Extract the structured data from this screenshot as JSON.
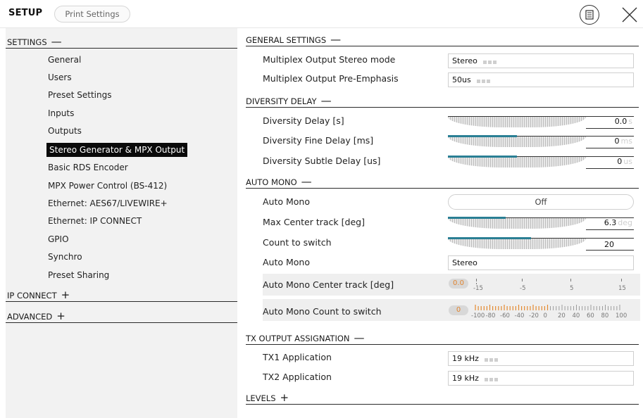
{
  "header": {
    "title": "SETUP",
    "print_button": "Print Settings"
  },
  "sidebar": {
    "settings_label": "SETTINGS",
    "settings_sign": "—",
    "items": [
      {
        "label": "General"
      },
      {
        "label": "Users"
      },
      {
        "label": "Preset Settings"
      },
      {
        "label": "Inputs"
      },
      {
        "label": "Outputs"
      },
      {
        "label": "Stereo Generator & MPX Output",
        "active": true
      },
      {
        "label": "Basic RDS Encoder"
      },
      {
        "label": "MPX Power Control (BS-412)"
      },
      {
        "label": "Ethernet: AES67/LIVEWIRE+"
      },
      {
        "label": "Ethernet: IP CONNECT"
      },
      {
        "label": "GPIO"
      },
      {
        "label": "Synchro"
      },
      {
        "label": "Preset Sharing"
      }
    ],
    "ip_connect_label": "IP CONNECT",
    "ip_connect_sign": "+",
    "advanced_label": "ADVANCED",
    "advanced_sign": "+"
  },
  "sections": {
    "general": {
      "title": "GENERAL SETTINGS",
      "sign": "—",
      "stereo_mode_label": "Multiplex Output Stereo mode",
      "stereo_mode_value": "Stereo",
      "pre_emphasis_label": "Multiplex Output Pre-Emphasis",
      "pre_emphasis_value": "50us"
    },
    "diversity": {
      "title": "DIVERSITY DELAY",
      "sign": "—",
      "delay_label": "Diversity Delay [s]",
      "delay_value": "0.0",
      "delay_unit": "s",
      "delay_fill": 0.0,
      "fine_label": "Diversity Fine Delay [ms]",
      "fine_value": "0",
      "fine_unit": "ms",
      "fine_fill": 0.5,
      "subtle_label": "Diversity Subtle Delay [us]",
      "subtle_value": "0",
      "subtle_unit": "us",
      "subtle_fill": 0.5
    },
    "auto_mono": {
      "title": "AUTO MONO",
      "sign": "—",
      "auto_mono_label": "Auto Mono",
      "auto_mono_value": "Off",
      "max_center_label": "Max Center track [deg]",
      "max_center_value": "6.3",
      "max_center_unit": "deg",
      "max_center_fill": 0.42,
      "count_label": "Count to switch",
      "count_value": "20",
      "count_fill": 0.6,
      "auto_mono2_label": "Auto Mono",
      "auto_mono2_value": "Stereo",
      "center_track_label": "Auto Mono Center track [deg]",
      "center_track_value": "0.0",
      "center_track_scale": [
        "-15",
        "-5",
        "5",
        "15"
      ],
      "count_switch_label": "Auto Mono Count to switch",
      "count_switch_value": "0",
      "count_switch_scale": [
        "-100",
        "-80",
        "-60",
        "-40",
        "-20",
        "0",
        "20",
        "40",
        "60",
        "80",
        "100"
      ]
    },
    "tx_output": {
      "title": "TX OUTPUT ASSIGNATION",
      "sign": "—",
      "tx1_label": "TX1 Application",
      "tx1_value": "19 kHz",
      "tx2_label": "TX2 Application",
      "tx2_value": "19 kHz"
    },
    "levels": {
      "title": "LEVELS",
      "sign": "+"
    }
  },
  "colors": {
    "accent": "#2a7f94",
    "meter_orange": "#e3892f",
    "active_bg": "#0a0a0a",
    "sidebar_bg": "#f2f2f2"
  },
  "icons": {
    "menu": "list-menu-icon",
    "close": "close-icon"
  }
}
